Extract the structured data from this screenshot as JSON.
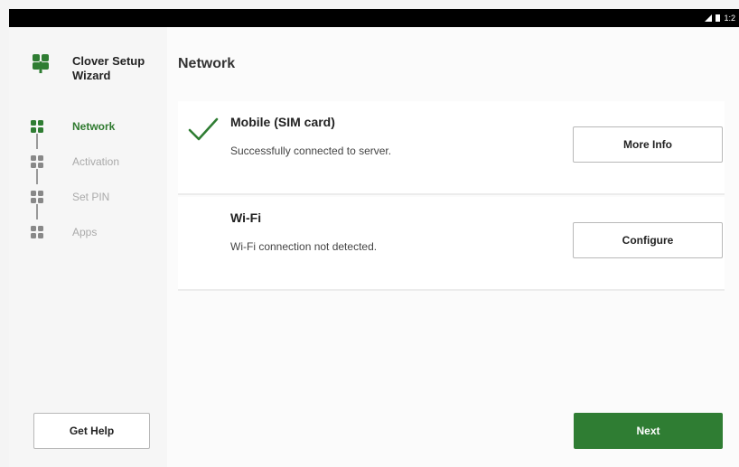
{
  "status_bar": {
    "time": "1:2"
  },
  "sidebar": {
    "app_title": "Clover Setup Wizard",
    "steps": [
      {
        "label": "Network",
        "active": true
      },
      {
        "label": "Activation",
        "active": false
      },
      {
        "label": "Set PIN",
        "active": false
      },
      {
        "label": "Apps",
        "active": false
      }
    ],
    "help_label": "Get Help"
  },
  "main": {
    "title": "Network",
    "mobile": {
      "title": "Mobile (SIM card)",
      "status": "Successfully connected to server.",
      "button_label": "More Info"
    },
    "wifi": {
      "title": "Wi-Fi",
      "status": "Wi-Fi connection not detected.",
      "button_label": "Configure"
    },
    "next_label": "Next"
  },
  "colors": {
    "accent": "#2f7d33",
    "inactive_text": "#aaaaaa"
  },
  "icons": {
    "logo": "clover-logo-icon",
    "check": "check-icon",
    "step": "clover-step-icon"
  }
}
